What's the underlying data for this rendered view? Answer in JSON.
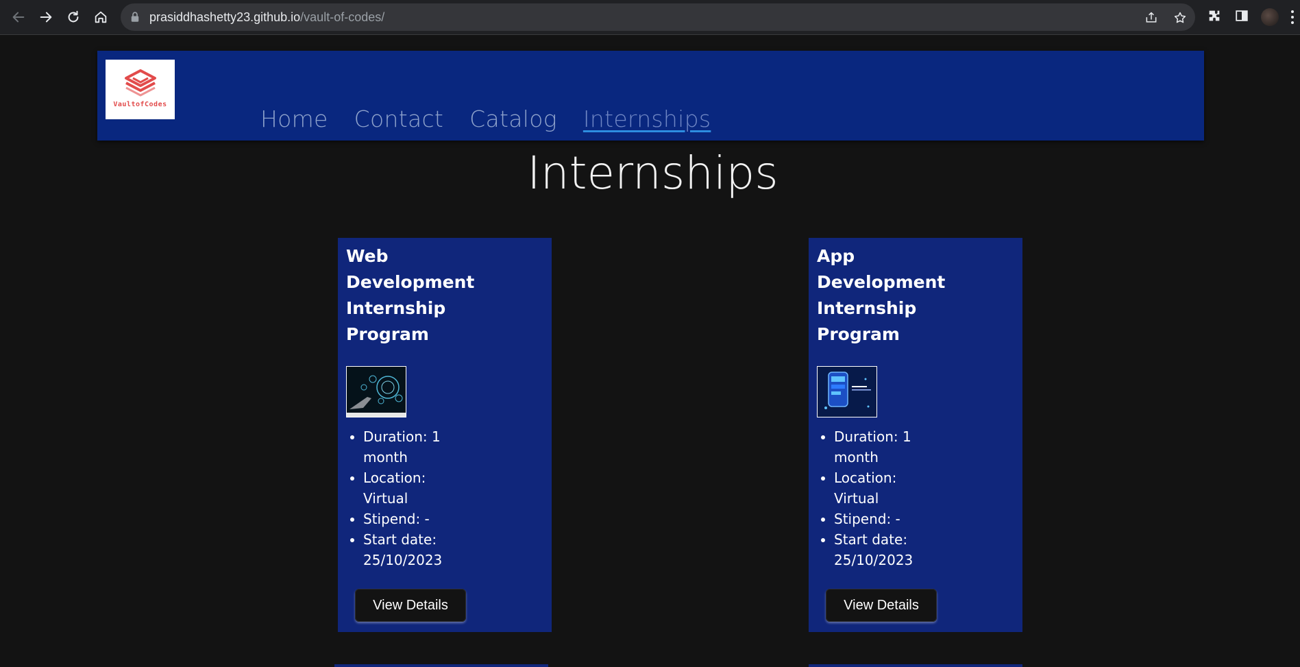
{
  "browser": {
    "url_host": "prasiddhashetty23.github.io",
    "url_path": "/vault-of-codes/"
  },
  "site": {
    "logo_text": "VaultofCodes",
    "menu": [
      {
        "label": "Home"
      },
      {
        "label": "Contact"
      },
      {
        "label": "Catalog"
      },
      {
        "label": "Internships",
        "active": true
      }
    ]
  },
  "page": {
    "title": "Internships"
  },
  "cards": [
    {
      "title": "Web Development Internship Program",
      "image_icon": "web-development-thumbnail",
      "details": [
        "Duration: 1 month",
        "Location: Virtual",
        "Stipend: -",
        "Start date: 25/10/2023"
      ],
      "button_label": "View Details"
    },
    {
      "title": "App Development Internship Program",
      "image_icon": "app-development-thumbnail",
      "details": [
        "Duration: 1 month",
        "Location: Virtual",
        "Stipend: -",
        "Start date: 25/10/2023"
      ],
      "button_label": "View Details"
    }
  ],
  "colors": {
    "page_bg": "#131313",
    "header_bg": "#09277f",
    "card_bg": "#10267b",
    "active_underline": "#2d8de0"
  }
}
